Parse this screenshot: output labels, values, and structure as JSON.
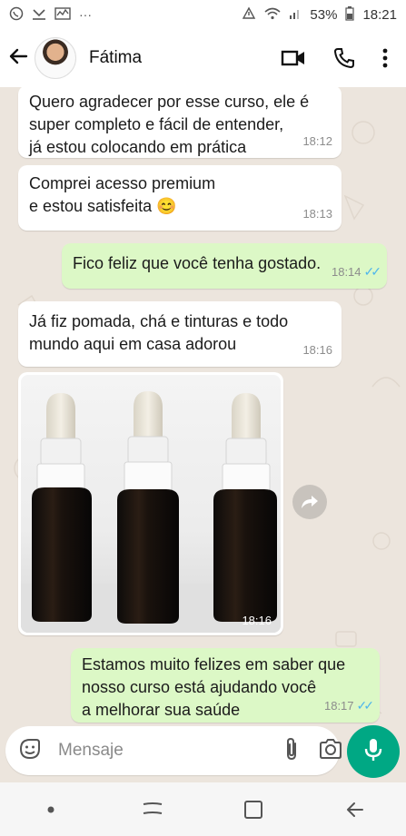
{
  "status_bar": {
    "battery": "53%",
    "time": "18:21",
    "left_icons": [
      "whatsapp-icon",
      "missed-call-icon",
      "activity-icon",
      "more-dots-icon"
    ],
    "right_icons": [
      "alarm-icon",
      "wifi-icon",
      "signal-icon",
      "battery-icon"
    ]
  },
  "header": {
    "contact_name": "Fátima",
    "icons": [
      "back-arrow-icon",
      "video-call-icon",
      "phone-icon",
      "menu-icon"
    ]
  },
  "messages": [
    {
      "direction": "in",
      "text": "Quero agradecer por esse curso, ele é\nsuper completo e fácil de entender,\njá estou colocando em prática",
      "time": "18:12"
    },
    {
      "direction": "in",
      "text": "Comprei acesso premium\ne estou satisfeita 😊",
      "time": "18:13"
    },
    {
      "direction": "out",
      "text": "Fico feliz que você tenha gostado.",
      "time": "18:14",
      "status": "read"
    },
    {
      "direction": "in",
      "text": "Já fiz pomada, chá e tinturas e todo\nmundo aqui em casa adorou",
      "time": "18:16"
    },
    {
      "direction": "in",
      "type": "image",
      "caption_time": "18:16",
      "image_subject": "three amber dropper bottles"
    },
    {
      "direction": "out",
      "text": "Estamos muito felizes em saber que\nnosso curso está ajudando você\na melhorar sua saúde",
      "time": "18:17",
      "status": "read"
    }
  ],
  "input": {
    "placeholder": "Mensaje",
    "icons": [
      "sticker-icon",
      "attach-icon",
      "camera-icon",
      "mic-icon"
    ]
  },
  "nav_bar": {
    "icons": [
      "dot-icon",
      "recents-icon",
      "home-icon",
      "back-icon"
    ]
  },
  "colors": {
    "chat_background": "#ece5dd",
    "outgoing_bubble": "#dcf8c6",
    "incoming_bubble": "#ffffff",
    "read_ticks": "#4fb6ec",
    "mic_button": "#00a884"
  }
}
